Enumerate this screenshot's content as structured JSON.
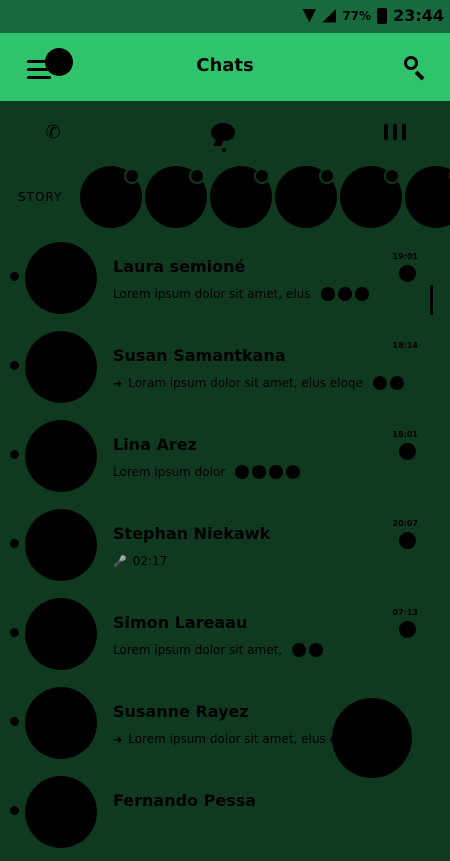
{
  "status_bar": {
    "battery_percent": "77%",
    "time": "23:44",
    "icons": [
      "wifi-icon",
      "signal-icon",
      "battery-icon"
    ]
  },
  "app_bar": {
    "title": "Chats",
    "menu_icon": "menu-icon",
    "search_icon": "search-icon"
  },
  "tabs": [
    {
      "name": "calls",
      "icon": "phone-icon"
    },
    {
      "name": "chats",
      "icon": "chat-bubble-icon",
      "active": true
    },
    {
      "name": "contacts",
      "icon": "contacts-icon"
    }
  ],
  "stories": {
    "label": "STORY",
    "count": 6
  },
  "chats": [
    {
      "name": "Laura semioné",
      "message": "Lorem ipsum dolor sit amet, elus",
      "time": "19:01",
      "emoji_count": 3,
      "unread": true,
      "message_icon": ""
    },
    {
      "name": "Susan Samantkana",
      "message": "Loram ipsum dolor sit amet, elus eloqe",
      "time": "18:14",
      "emoji_count": 2,
      "unread": false,
      "message_icon": "arrow-icon"
    },
    {
      "name": "Lina Arez",
      "message": "Lorem ipsum dolor",
      "time": "18:01",
      "emoji_count": 4,
      "unread": true,
      "message_icon": ""
    },
    {
      "name": "Stephan Niekawk",
      "message": "02:17",
      "time": "20:07",
      "emoji_count": 0,
      "unread": true,
      "message_icon": "mic-icon"
    },
    {
      "name": "Simon Lareaau",
      "message": "Lorem ipsum dolor sit amet,",
      "time": "07:13",
      "emoji_count": 2,
      "unread": true,
      "message_icon": ""
    },
    {
      "name": "Susanne Rayez",
      "message": "Lorem ipsum dolor sit amet, elus el",
      "time": "",
      "emoji_count": 0,
      "unread": false,
      "message_icon": "arrow-icon"
    },
    {
      "name": "Fernando Pessa",
      "message": "",
      "time": "",
      "emoji_count": 0,
      "unread": false,
      "message_icon": ""
    }
  ],
  "colors": {
    "background": "#0f3a1f",
    "status_bar": "#176a3b",
    "app_bar": "#2fc46c",
    "accent": "#000000"
  }
}
